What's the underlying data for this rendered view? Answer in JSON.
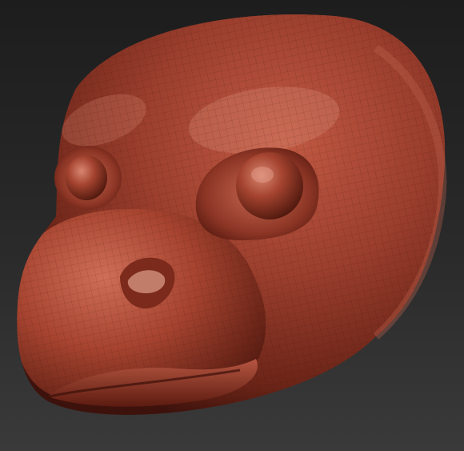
{
  "viewport": {
    "subject": "sculpted-creature-head",
    "material_color": "#9c3f2e",
    "highlight_color": "#d89a86",
    "shadow_color": "#3e120c",
    "background_top": "#1d1d1d",
    "background_bottom": "#3a3a3a",
    "wireframe_visible": true
  }
}
